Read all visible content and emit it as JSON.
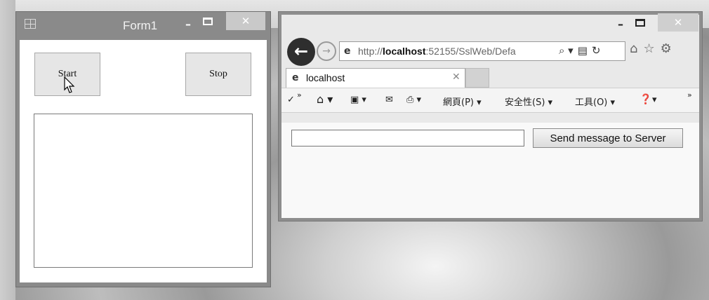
{
  "form1": {
    "title": "Form1",
    "minimize_glyph": "–",
    "close_glyph": "✕",
    "start_label": "Start",
    "stop_label": "Stop"
  },
  "browser": {
    "minimize_glyph": "–",
    "close_glyph": "✕",
    "back_glyph": "←",
    "forward_glyph": "→",
    "url_prefix": "http://",
    "url_host": "localhost",
    "url_rest": ":52155/SslWeb/Defa",
    "address_tools": [
      "⌕ ▾",
      "▤",
      "↻"
    ],
    "right_icons": [
      "⌂",
      "☆",
      "⚙"
    ],
    "tab": {
      "label": "localhost",
      "close_glyph": "✕"
    },
    "command_bar": {
      "chevron_left": "»",
      "page_menu": "網頁(P) ▾",
      "safety_menu": "安全性(S) ▾",
      "tools_menu": "工具(O) ▾",
      "help_menu": "▾",
      "chevron_right": "»"
    },
    "page": {
      "message_value": "",
      "send_label": "Send message to Server"
    }
  },
  "colors": {
    "desktop": "#9a9a9a",
    "window_frame": "#8a8a8a",
    "client_bg": "#ffffff",
    "button_face": "#e6e6e6"
  }
}
